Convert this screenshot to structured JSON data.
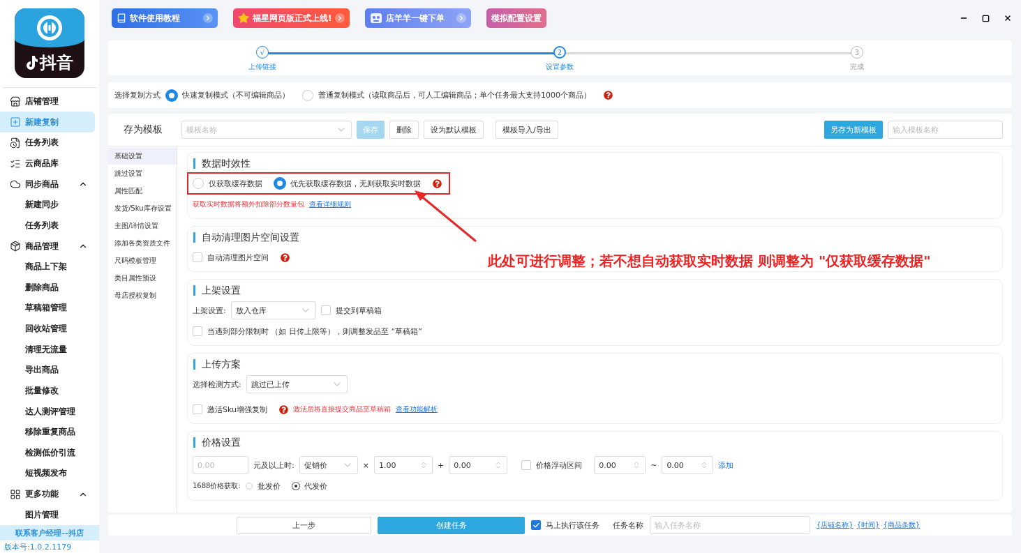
{
  "top_buttons": [
    {
      "label": "软件使用教程",
      "kind": "tutorial"
    },
    {
      "label": "福星网页版正式上线!",
      "kind": "launch"
    },
    {
      "label": "店羊羊一键下单",
      "kind": "order"
    },
    {
      "label": "模拟配置设置",
      "kind": "config"
    }
  ],
  "sidebar": {
    "logo_text": "抖音",
    "items": [
      {
        "label": "店铺管理",
        "selected": false
      },
      {
        "label": "新建复制",
        "selected": true
      },
      {
        "label": "任务列表",
        "selected": false
      },
      {
        "label": "云商品库",
        "selected": false
      },
      {
        "label": "同步商品",
        "selected": false,
        "expanded": true,
        "children": [
          {
            "label": "新建同步",
            "selected": false
          },
          {
            "label": "任务列表",
            "selected": false
          }
        ]
      },
      {
        "label": "商品管理",
        "selected": false,
        "expanded": true,
        "children": [
          {
            "label": "商品上下架",
            "selected": false
          },
          {
            "label": "删除商品",
            "selected": false
          },
          {
            "label": "草稿箱管理",
            "selected": false
          },
          {
            "label": "回收站管理",
            "selected": false
          },
          {
            "label": "清理无流量",
            "selected": false
          },
          {
            "label": "导出商品",
            "selected": false
          },
          {
            "label": "批量修改",
            "selected": false
          },
          {
            "label": "达人测评管理",
            "selected": false
          },
          {
            "label": "移除重复商品",
            "selected": false
          },
          {
            "label": "检测低价引流",
            "selected": false
          },
          {
            "label": "短视频发布",
            "selected": false
          }
        ]
      },
      {
        "label": "更多功能",
        "selected": false,
        "expanded": true,
        "children": [
          {
            "label": "图片管理",
            "selected": false
          }
        ]
      }
    ],
    "contact": "联系客户经理--抖店",
    "version": "版本号:1.0.2.1179"
  },
  "steps": [
    {
      "mark": "√",
      "label": "上传链接",
      "completed": true,
      "selected": false
    },
    {
      "mark": "2",
      "label": "设置参数",
      "completed": false,
      "selected": true
    },
    {
      "mark": "3",
      "label": "完成",
      "completed": false,
      "selected": false
    }
  ],
  "copy_mode": {
    "label": "选择复制方式",
    "options": [
      {
        "label": "快速复制模式（不可编辑商品）",
        "selected": true
      },
      {
        "label": "普通复制模式（读取商品后，可人工编辑商品；单个任务最大支持1000个商品）",
        "selected": false
      }
    ]
  },
  "template": {
    "title": "存为模板",
    "select_placeholder": "模板名称",
    "buttons": [
      {
        "label": "保存",
        "kind": "primary",
        "disabled": true
      },
      {
        "label": "删除",
        "kind": "plain",
        "disabled": false
      },
      {
        "label": "设为默认模板",
        "kind": "plain",
        "disabled": false
      },
      {
        "label": "模板导入/导出",
        "kind": "plain",
        "disabled": false
      }
    ],
    "save_new": "另存为新模板",
    "name_placeholder": "输入模板名称"
  },
  "nav": [
    {
      "label": "基础设置",
      "selected": true
    },
    {
      "label": "跳过设置",
      "selected": false
    },
    {
      "label": "属性匹配",
      "selected": false
    },
    {
      "label": "发货/Sku库存设置",
      "selected": false
    },
    {
      "label": "主图/详情设置",
      "selected": false
    },
    {
      "label": "添加各类资质文件",
      "selected": false
    },
    {
      "label": "尺码模板管理",
      "selected": false
    },
    {
      "label": "类目属性预设",
      "selected": false
    },
    {
      "label": "母店授权复制",
      "selected": false
    }
  ],
  "sections": [
    {
      "kind": "freshness",
      "title": "数据时效性",
      "highlighted": true,
      "options": [
        {
          "label": "仅获取缓存数据",
          "selected": false
        },
        {
          "label": "优先获取缓存数据，无则获取实时数据",
          "selected": true
        }
      ],
      "note": "获取实时数据将额外扣除部分数量包",
      "link": "查看详细规则"
    },
    {
      "kind": "cleanup",
      "title": "自动清理图片空间设置",
      "checkbox": {
        "label": "自动清理图片空间",
        "checked": false
      }
    },
    {
      "kind": "listing",
      "title": "上架设置",
      "select_label": "上架设置:",
      "select_value": "放入仓库",
      "draft": {
        "label": "提交到草稿箱",
        "checked": false
      },
      "limit": {
        "label": "当遇到部分限制时 （如 日传上限等），则调整发品至 “草稿箱”",
        "checked": false
      }
    },
    {
      "kind": "upload",
      "title": "上传方案",
      "select_label": "选择检测方式:",
      "select_value": "跳过已上传",
      "checkbox": {
        "label": "激活Sku增强复制",
        "checked": false
      },
      "warning": "激活后将直接提交商品至草稿箱",
      "link": "查看功能解析"
    },
    {
      "kind": "price",
      "title": "价格设置",
      "min_placeholder": "0.00",
      "when_label": "元及以上时:",
      "price_type": "促销价",
      "times": "×",
      "multiplier": "1.00",
      "plus": "+",
      "addend": "0.00",
      "float": {
        "label": "价格浮动区间",
        "checked": false
      },
      "float_min": "0.00",
      "tilde": "~",
      "float_max": "0.00",
      "add_link": "添加",
      "source_label": "1688价格获取:",
      "sources": [
        {
          "label": "批发价",
          "selected": false
        },
        {
          "label": "代发价",
          "selected": true
        }
      ]
    }
  ],
  "annotation": "此处可进行调整；若不想自动获取实时数据 则调整为 \"仅获取缓存数据\"",
  "bottom": {
    "prev": "上一步",
    "create": "创建任务",
    "run_now": {
      "label": "马上执行该任务",
      "checked": true
    },
    "task_label": "任务名称",
    "task_placeholder": "输入任务名称",
    "tokens": [
      "{店铺名称}",
      "{时间}",
      "{商品条数}"
    ]
  }
}
